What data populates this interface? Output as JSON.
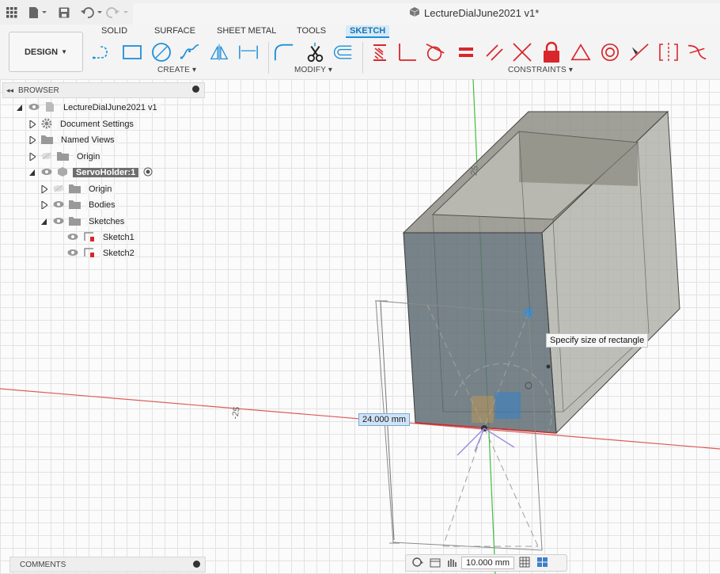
{
  "window": {
    "title": "LectureDialJune2021 v1*"
  },
  "workspace": {
    "label": "DESIGN"
  },
  "tabs": [
    {
      "label": "SOLID",
      "active": false
    },
    {
      "label": "SURFACE",
      "active": false
    },
    {
      "label": "SHEET METAL",
      "active": false
    },
    {
      "label": "TOOLS",
      "active": false
    },
    {
      "label": "SKETCH",
      "active": true
    }
  ],
  "groups": {
    "create": "CREATE",
    "modify": "MODIFY",
    "constraints": "CONSTRAINTS"
  },
  "browser": {
    "header": "BROWSER",
    "items": [
      {
        "label": "LectureDialJune2021 v1"
      },
      {
        "label": "Document Settings"
      },
      {
        "label": "Named Views"
      },
      {
        "label": "Origin"
      },
      {
        "label": "ServoHolder:1"
      },
      {
        "label": "Origin"
      },
      {
        "label": "Bodies"
      },
      {
        "label": "Sketches"
      },
      {
        "label": "Sketch1"
      },
      {
        "label": "Sketch2"
      }
    ]
  },
  "viewport": {
    "tooltip": "Specify size of rectangle",
    "dimension_input": "24.000 mm",
    "axis_label_left": "-25",
    "axis_label_top": "25"
  },
  "comments": {
    "label": "COMMENTS"
  },
  "bottom_toolbar": {
    "dimension": "10.000 mm"
  },
  "colors": {
    "accent": "#1d8fd8",
    "red_constraint": "#d9262b",
    "x_axis": "#e05a5a",
    "y_axis": "#3fbf3f"
  }
}
